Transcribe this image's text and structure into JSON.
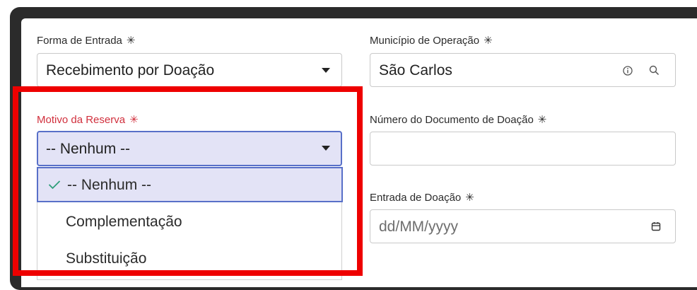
{
  "form": {
    "forma_entrada": {
      "label": "Forma de Entrada",
      "required": "✳",
      "value": "Recebimento por Doação"
    },
    "municipio": {
      "label": "Município de Operação",
      "required": "✳",
      "value": "São Carlos"
    },
    "motivo_reserva": {
      "label": "Motivo da Reserva",
      "required": "✳",
      "value": "-- Nenhum --"
    },
    "numero_documento": {
      "label": "Número do Documento de Doação",
      "required": "✳",
      "value": ""
    },
    "entrada_doacao": {
      "label": "Entrada de Doação",
      "required": "✳",
      "placeholder": "dd/MM/yyyy"
    }
  },
  "dropdown": {
    "options": [
      "-- Nenhum --",
      "Complementação",
      "Substituição"
    ],
    "selected": "-- Nenhum --"
  },
  "colors": {
    "error_label": "#d1303d",
    "focus_border": "#5870c8",
    "focus_bg": "#e3e3f6",
    "highlight": "#ee0000",
    "check": "#2e9e7a"
  },
  "icons": [
    "info-icon",
    "search-icon",
    "calendar-icon",
    "checkmark-icon",
    "caret-down-icon"
  ]
}
